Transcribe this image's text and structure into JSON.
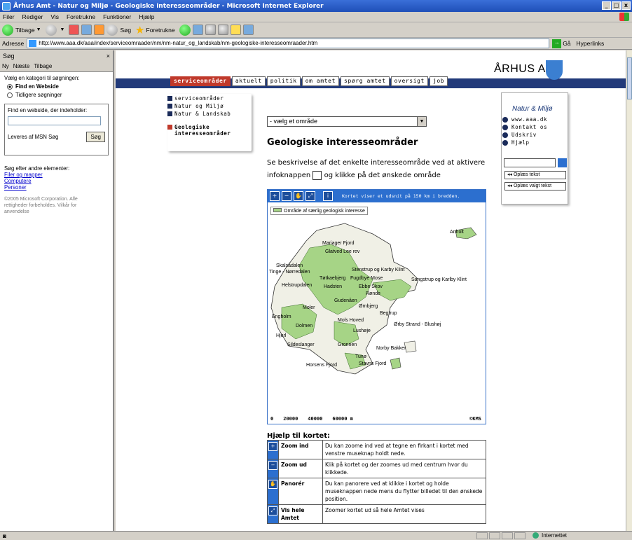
{
  "window": {
    "title": "Århus Amt - Natur og Miljø - Geologiske interesseområder - Microsoft Internet Explorer",
    "buttons": [
      "_",
      "□",
      "x"
    ]
  },
  "menu": [
    "Filer",
    "Rediger",
    "Vis",
    "Foretrukne",
    "Funktioner",
    "Hjælp"
  ],
  "toolbar": {
    "back": "Tilbage",
    "search": "Søg",
    "favorites": "Foretrukne"
  },
  "address": {
    "label": "Adresse",
    "url": "http://www.aaa.dk/aaa/index/serviceomraader/nm/nm-natur_og_landskab/nm-geologiske-interesseomraader.htm",
    "go": "Gå",
    "links": "Hyperlinks"
  },
  "search_pane": {
    "title": "Søg",
    "close": "×",
    "new": "Ny",
    "next": "Næste",
    "back": "Tilbage",
    "category_prompt": "Vælg en kategori til søgningen:",
    "option_find": "Find en Webside",
    "option_previous": "Tidligere søgninger",
    "find_label": "Find en webside, der indeholder:",
    "provider": "Leveres af MSN Søg",
    "search_button": "Søg",
    "other_label": "Søg efter andre elementer:",
    "links": [
      "Filer og mapper",
      "Computere",
      "Personer"
    ],
    "copyright": "©2005 Microsoft Corporation. Alle rettigheder forbeholdes.   Vilkår for anvendelse"
  },
  "site": {
    "nav_tabs": [
      "serviceområder",
      "aktuelt",
      "politik",
      "om amtet",
      "spørg amtet",
      "oversigt",
      "job"
    ],
    "logo": "ÅRHUS AMT",
    "left_menu": [
      "serviceområder",
      "Natur og Miljø",
      "Natur & Landskab"
    ],
    "left_menu_selected": "Geologiske interesseområder",
    "area_select": "- vælg et område",
    "page_title": "Geologiske interesseområder",
    "intro_part1": "Se beskrivelse af det enkelte interesseområde ved at aktivere infoknappen",
    "intro_part2": "og klikke på det ønskede område"
  },
  "map": {
    "info": "Kortet viser et udsnit på 150 km i bredden.",
    "legend": "Område af særlig geologisk interesse",
    "scale": [
      "0",
      "20000",
      "40000",
      "60000 m"
    ],
    "copyright": "©KMS",
    "labels": [
      "Anholt",
      "Mariager Fjord",
      "Glatved Lee rev",
      "Skalsådalen",
      "Tinge - Nørredalen",
      "Stenstrup og Karby Klint",
      "Tøtkaebjerg",
      "Fugdbye Mose",
      "Sangstrup og Karlby Klint",
      "Helstrupdalen",
      "Hadsten",
      "Ebbe Skov",
      "Rønde",
      "Gudenåen",
      "Moler",
      "Mols Hoved",
      "Begtrup",
      "Engholm",
      "Dolmen",
      "Ørnbjerg",
      "Lushøje",
      "Ørby Strand - Blushøj",
      "Horsens Fjord",
      "Tunø",
      "Norby Bakker",
      "Stavns Fjord",
      "Hjerl",
      "Sildeslanger",
      "Gronnen"
    ]
  },
  "help": {
    "title": "Hjælp til kortet:",
    "rows": [
      {
        "name": "Zoom ind",
        "text": "Du kan zoome ind ved at tegne en firkant i kortet med venstre museknap holdt nede."
      },
      {
        "name": "Zoom ud",
        "text": "Klik på kortet og der zoomes ud med centrum hvor du klikkede."
      },
      {
        "name": "Panorér",
        "text": "Du kan panorere ved at klikke i kortet og holde museknappen nede mens du flytter billedet til den ønskede position."
      },
      {
        "name": "Vis hele Amtet",
        "text": "Zoomer kortet ud så hele Amtet vises"
      }
    ]
  },
  "rbox": {
    "title": "Natur & Miljø",
    "links": [
      "www.aaa.dk",
      "Kontakt os",
      "Udskriv",
      "Hjælp"
    ],
    "read_text": "Oplæs tekst",
    "read_selected": "Oplæs valgt tekst"
  },
  "status": {
    "zone": "Internettet"
  }
}
